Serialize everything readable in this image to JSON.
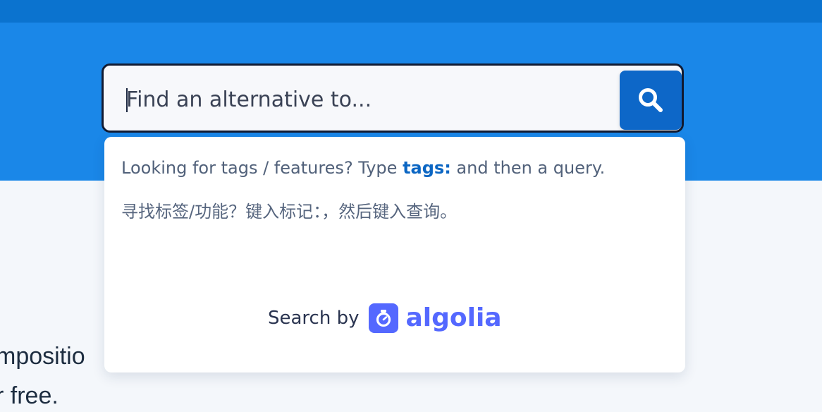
{
  "search": {
    "placeholder": "Find an alternative to...",
    "value": "",
    "button_icon": "search-icon"
  },
  "dropdown": {
    "hint_prefix": "Looking for tags / features? Type ",
    "hint_keyword": "tags:",
    "hint_suffix": " and then a query.",
    "hint_chinese": "寻找标签/功能？键入标记：，然后键入查询。",
    "search_by_label": "Search by",
    "provider_name": "algolia",
    "provider_icon": "algolia-stopwatch-icon"
  },
  "background": {
    "line_1": "mpositio",
    "line_2": "r free."
  },
  "colors": {
    "top_strip": "#0b73cf",
    "hero": "#1a87e8",
    "search_button": "#0d67c8",
    "tag_keyword": "#0b66c3",
    "algolia_brand": "#5468ff"
  }
}
